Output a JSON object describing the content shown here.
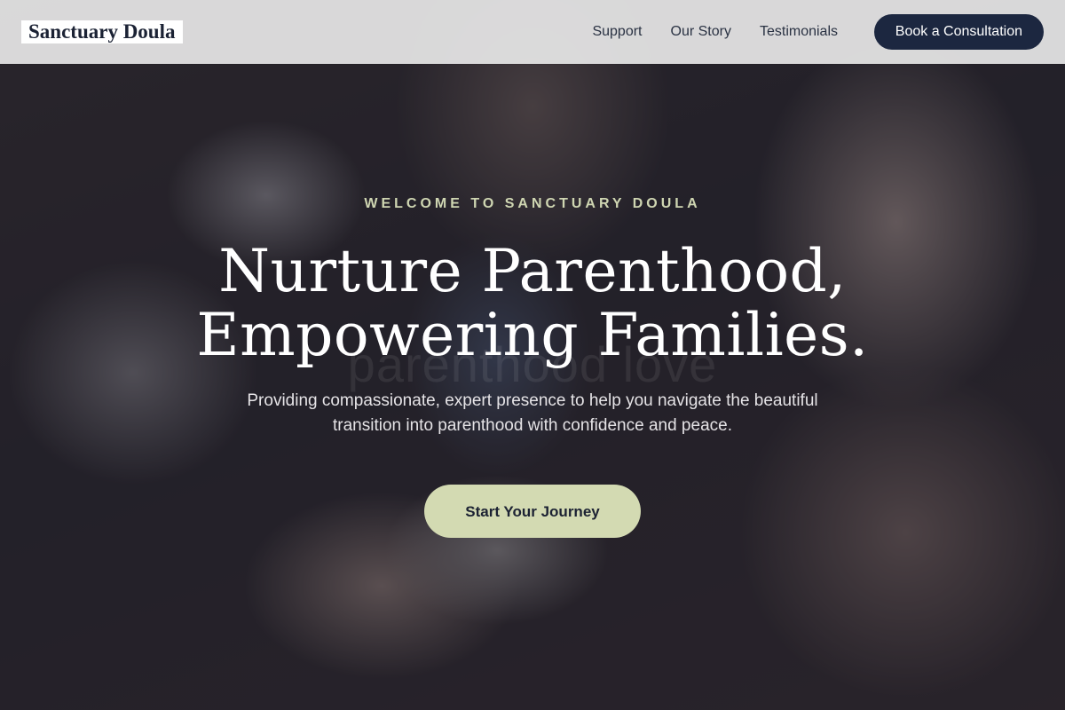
{
  "brand": {
    "name": "Sanctuary Doula"
  },
  "nav": {
    "links": [
      "Support",
      "Our Story",
      "Testimonials"
    ],
    "cta_label": "Book a Consultation"
  },
  "hero": {
    "eyebrow": "WELCOME TO SANCTUARY DOULA",
    "headline_line1": "Nurture Parenthood,",
    "headline_line2": "Empowering Families.",
    "subtext": "Providing compassionate, expert presence to help you navigate the beautiful transition into parenthood with confidence and peace.",
    "cta_label": "Start Your Journey",
    "ghost_text": "parenthood love"
  },
  "colors": {
    "header_bg": "#e8e8e8",
    "primary_dark": "#1c2740",
    "accent_sage": "#d3dab2",
    "eyebrow_sage": "#cfd6b2"
  }
}
